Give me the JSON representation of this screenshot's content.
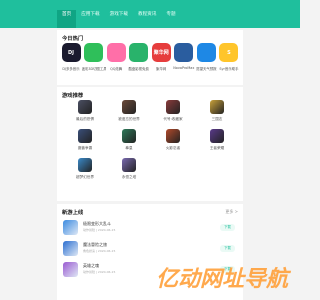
{
  "nav": {
    "items": [
      "首页",
      "应用下载",
      "游戏下载",
      "教程资讯",
      "专题"
    ]
  },
  "hot": {
    "title": "今日热门",
    "items": [
      {
        "label": "DJ多多音乐",
        "icon_text": "DJ",
        "icon": "dj-app-icon",
        "color": "#1a1a2e"
      },
      {
        "label": "迷彩3D切图工具",
        "icon_text": "",
        "icon": "shirt-app-icon",
        "color": "#2fbf5a"
      },
      {
        "label": "QQ炫舞",
        "icon_text": "",
        "icon": "pink-bird-app-icon",
        "color": "#ff6fa8"
      },
      {
        "label": "酷盘影视免费",
        "icon_text": "",
        "icon": "home-app-icon",
        "color": "#29b36b"
      },
      {
        "label": "聚华网",
        "icon_text": "聚华网",
        "icon": "jh-app-icon",
        "color": "#e63d3d"
      },
      {
        "label": "NovaProMax",
        "icon_text": "",
        "icon": "grid-app-icon",
        "color": "#2a5d9f"
      },
      {
        "label": "愿望天气预报",
        "icon_text": "",
        "icon": "paper-plane-app-icon",
        "color": "#1e88e5"
      },
      {
        "label": "Syr音乐助手",
        "icon_text": "S",
        "icon": "s-app-icon",
        "color": "#ffc52b"
      }
    ]
  },
  "games": {
    "title": "游戏推荐",
    "items": [
      {
        "label": "最后的恐惧",
        "color": "#4b4f63",
        "icon": "game-icon"
      },
      {
        "label": "被遗忘的世界",
        "color": "#6b4a3a",
        "icon": "game-icon"
      },
      {
        "label": "代号:收藏家",
        "color": "#8a3b3b",
        "icon": "game-icon"
      },
      {
        "label": "三国志",
        "color": "#c9a13a",
        "icon": "game-icon"
      },
      {
        "label": "魔兽争霸",
        "color": "#3a4f7a",
        "icon": "game-icon"
      },
      {
        "label": "拳皇",
        "color": "#2e7a5a",
        "icon": "game-icon"
      },
      {
        "label": "火影忍者",
        "color": "#b24a2b",
        "icon": "game-icon"
      },
      {
        "label": "王者荣耀",
        "color": "#5a3a8a",
        "icon": "game-icon"
      },
      {
        "label": "超梦幻世界",
        "color": "#3a8ac9",
        "icon": "game-icon"
      },
      {
        "label": "永恒之塔",
        "color": "#7a6ab0",
        "icon": "game-icon"
      }
    ]
  },
  "new": {
    "title": "新游上线",
    "more": "更多 >",
    "items": [
      {
        "title": "极限变形大乱斗",
        "meta": "动作冒险 | 2020-06-15",
        "button": "下载",
        "color": "#3a8ae0",
        "icon": "new-game-icon"
      },
      {
        "title": "魔法冒险之旅",
        "meta": "角色扮演 | 2020-06-15",
        "button": "下载",
        "color": "#2b6fd1",
        "icon": "new-game-icon"
      },
      {
        "title": "英雄之魂",
        "meta": "动作冒险 | 2020-06-15",
        "button": "下载",
        "color": "#9a5ad1",
        "icon": "new-game-icon"
      }
    ]
  },
  "watermark": {
    "text": "亿动网址导航"
  }
}
